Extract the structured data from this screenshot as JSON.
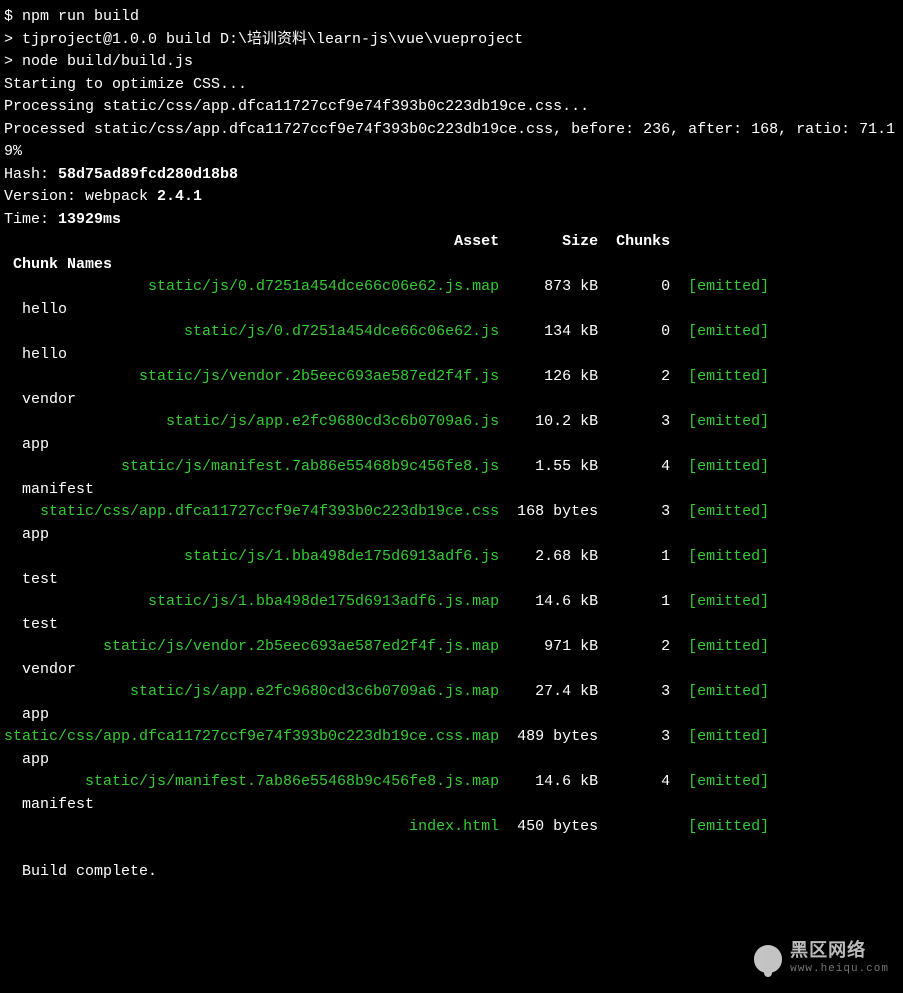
{
  "prompt": "$ npm run build",
  "blank1": "",
  "project_line": "> tjproject@1.0.0 build D:\\培训资料\\learn-js\\vue\\vueproject",
  "node_line": "> node build/build.js",
  "blank2": "",
  "blank3": "",
  "css_start": "Starting to optimize CSS...",
  "css_processing": "Processing static/css/app.dfca11727ccf9e74f393b0c223db19ce.css...",
  "css_processed": "Processed static/css/app.dfca11727ccf9e74f393b0c223db19ce.css, before: 236, after: 168, ratio: 71.19%",
  "hash_label": "Hash: ",
  "hash_value": "58d75ad89fcd280d18b8",
  "version_label": "Version: webpack ",
  "version_value": "2.4.1",
  "time_label": "Time: ",
  "time_value": "13929ms",
  "header": {
    "asset": "Asset",
    "size": "Size",
    "chunks": "Chunks",
    "chunk_names": "Chunk Names"
  },
  "rows": [
    {
      "asset": "static/js/0.d7251a454dce66c06e62.js.map",
      "size": "873 kB",
      "chunk": "0",
      "flag": "[emitted]",
      "name": "hello"
    },
    {
      "asset": "static/js/0.d7251a454dce66c06e62.js",
      "size": "134 kB",
      "chunk": "0",
      "flag": "[emitted]",
      "name": "hello"
    },
    {
      "asset": "static/js/vendor.2b5eec693ae587ed2f4f.js",
      "size": "126 kB",
      "chunk": "2",
      "flag": "[emitted]",
      "name": "vendor"
    },
    {
      "asset": "static/js/app.e2fc9680cd3c6b0709a6.js",
      "size": "10.2 kB",
      "chunk": "3",
      "flag": "[emitted]",
      "name": "app"
    },
    {
      "asset": "static/js/manifest.7ab86e55468b9c456fe8.js",
      "size": "1.55 kB",
      "chunk": "4",
      "flag": "[emitted]",
      "name": "manifest"
    },
    {
      "asset": "static/css/app.dfca11727ccf9e74f393b0c223db19ce.css",
      "size": "168 bytes",
      "chunk": "3",
      "flag": "[emitted]",
      "name": "app"
    },
    {
      "asset": "static/js/1.bba498de175d6913adf6.js",
      "size": "2.68 kB",
      "chunk": "1",
      "flag": "[emitted]",
      "name": "test"
    },
    {
      "asset": "static/js/1.bba498de175d6913adf6.js.map",
      "size": "14.6 kB",
      "chunk": "1",
      "flag": "[emitted]",
      "name": "test"
    },
    {
      "asset": "static/js/vendor.2b5eec693ae587ed2f4f.js.map",
      "size": "971 kB",
      "chunk": "2",
      "flag": "[emitted]",
      "name": "vendor"
    },
    {
      "asset": "static/js/app.e2fc9680cd3c6b0709a6.js.map",
      "size": "27.4 kB",
      "chunk": "3",
      "flag": "[emitted]",
      "name": "app"
    },
    {
      "asset": "static/css/app.dfca11727ccf9e74f393b0c223db19ce.css.map",
      "size": "489 bytes",
      "chunk": "3",
      "flag": "[emitted]",
      "name": "app"
    },
    {
      "asset": "static/js/manifest.7ab86e55468b9c456fe8.js.map",
      "size": "14.6 kB",
      "chunk": "4",
      "flag": "[emitted]",
      "name": "manifest"
    },
    {
      "asset": "index.html",
      "size": "450 bytes",
      "chunk": "",
      "flag": "[emitted]",
      "name": ""
    }
  ],
  "build_complete": "  Build complete.",
  "watermark": {
    "main": "黑区网络",
    "sub": "www.heiqu.com"
  },
  "layout": {
    "asset_w": 55,
    "size_w": 11,
    "chunk_w": 8,
    "wrap": 85
  }
}
